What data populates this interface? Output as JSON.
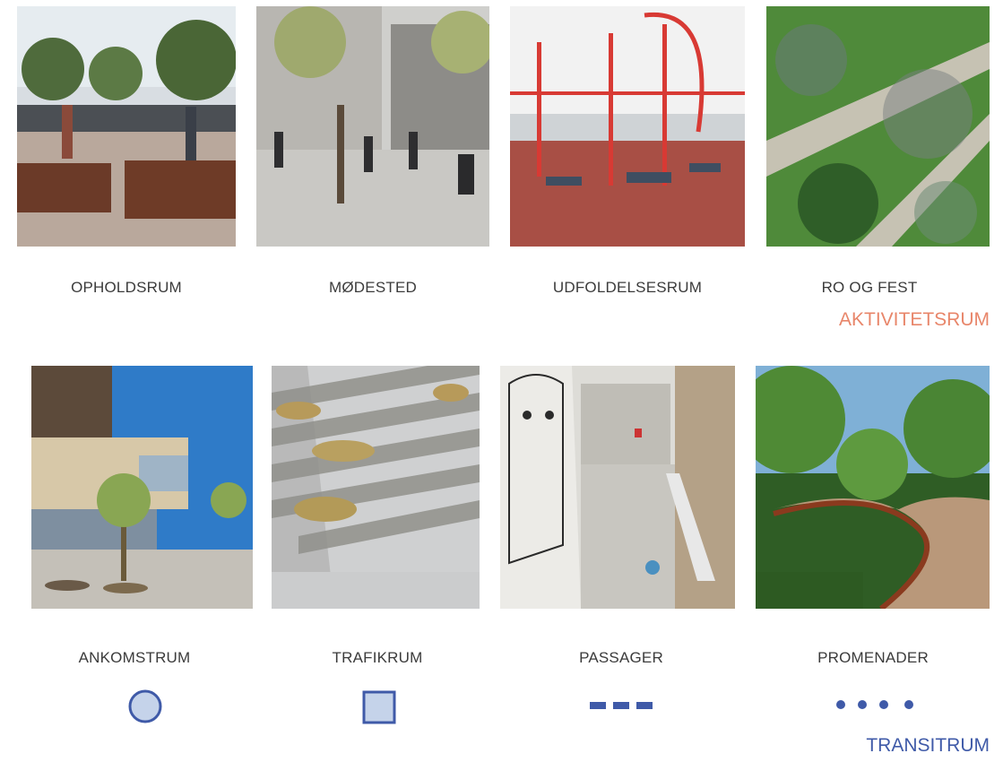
{
  "activity": {
    "section_label": "AKTIVITETSRUM",
    "section_color": "#e8866a",
    "items": [
      {
        "caption": "OPHOLDSRUM"
      },
      {
        "caption": "MØDESTED"
      },
      {
        "caption": "UDFOLDELSESRUM"
      },
      {
        "caption": "RO OG FEST"
      }
    ]
  },
  "transit": {
    "section_label": "TRANSITRUM",
    "section_color": "#3f5aa8",
    "items": [
      {
        "caption": "ANKOMSTRUM",
        "symbol": "circle-icon"
      },
      {
        "caption": "TRAFIKRUM",
        "symbol": "square-icon"
      },
      {
        "caption": "PASSAGER",
        "symbol": "dashed-line-icon"
      },
      {
        "caption": "PROMENADER",
        "symbol": "dotted-line-icon"
      }
    ]
  },
  "colors": {
    "symbol_stroke": "#3f5aa8",
    "symbol_fill": "#c5d3ea"
  }
}
